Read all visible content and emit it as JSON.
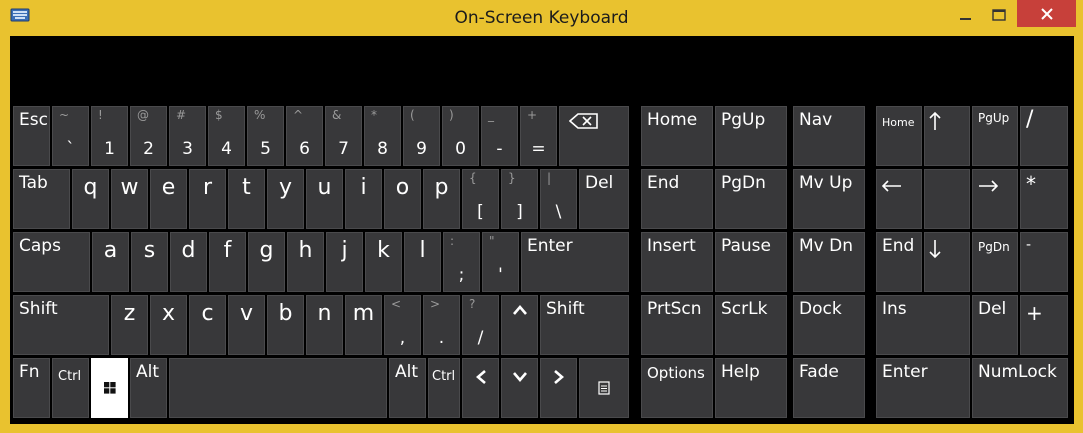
{
  "window": {
    "title": "On-Screen Keyboard",
    "icons": {
      "app": "keyboard-app-icon",
      "minimize": "minimize-icon",
      "maximize": "maximize-icon",
      "close": "close-icon"
    },
    "colors": {
      "frame": "#e9c22f",
      "key": "#38383a",
      "key_highlight": "#ffffff",
      "close": "#c7403a",
      "background": "#000000"
    }
  },
  "keys": {
    "esc": "Esc",
    "n1": {
      "shift": "!",
      "main": "1"
    },
    "n2": {
      "shift": "@",
      "main": "2"
    },
    "n3": {
      "shift": "#",
      "main": "3"
    },
    "n4": {
      "shift": "$",
      "main": "4"
    },
    "n5": {
      "shift": "%",
      "main": "5"
    },
    "n6": {
      "shift": "^",
      "main": "6"
    },
    "n7": {
      "shift": "&",
      "main": "7"
    },
    "n8": {
      "shift": "*",
      "main": "8"
    },
    "n9": {
      "shift": "(",
      "main": "9"
    },
    "n0": {
      "shift": ")",
      "main": "0"
    },
    "backtick": {
      "shift": "~",
      "main": "`"
    },
    "minus": {
      "shift": "_",
      "main": "-"
    },
    "equals": {
      "shift": "+",
      "main": "="
    },
    "tab": "Tab",
    "q": "q",
    "w": "w",
    "e": "e",
    "r": "r",
    "t": "t",
    "y": "y",
    "u": "u",
    "i": "i",
    "o": "o",
    "p": "p",
    "lbracket": {
      "shift": "{",
      "main": "["
    },
    "rbracket": {
      "shift": "}",
      "main": "]"
    },
    "backslash": {
      "shift": "|",
      "main": "\\"
    },
    "del": "Del",
    "caps": "Caps",
    "a": "a",
    "s": "s",
    "d": "d",
    "f": "f",
    "g": "g",
    "h": "h",
    "j": "j",
    "k": "k",
    "l": "l",
    "semicolon": {
      "shift": ":",
      "main": ";"
    },
    "quote": {
      "shift": "\"",
      "main": "'"
    },
    "enter": "Enter",
    "lshift": "Shift",
    "z": "z",
    "x": "x",
    "c": "c",
    "v": "v",
    "b": "b",
    "n": "n",
    "m": "m",
    "comma": {
      "shift": "<",
      "main": ","
    },
    "period": {
      "shift": ">",
      "main": "."
    },
    "slash": {
      "shift": "?",
      "main": "/"
    },
    "rshift": "Shift",
    "fn": "Fn",
    "lctrl": "Ctrl",
    "lalt": "Alt",
    "ralt": "Alt",
    "rctrl": "Ctrl",
    "home": "Home",
    "pgup": "PgUp",
    "nav": "Nav",
    "end": "End",
    "pgdn": "PgDn",
    "mvup": "Mv Up",
    "insert": "Insert",
    "pause": "Pause",
    "mvdn": "Mv Dn",
    "prtscn": "PrtScn",
    "scrlk": "ScrLk",
    "dock": "Dock",
    "options": "Options",
    "help": "Help",
    "fade": "Fade",
    "np_home": "Home",
    "np_slash": "/",
    "np_star": "*",
    "np_end": "End",
    "np_pgdn": "PgDn",
    "np_minus": "-",
    "np_ins": "Ins",
    "np_del": "Del",
    "np_plus": "+",
    "np_enter": "Enter",
    "numlock": "NumLock"
  }
}
